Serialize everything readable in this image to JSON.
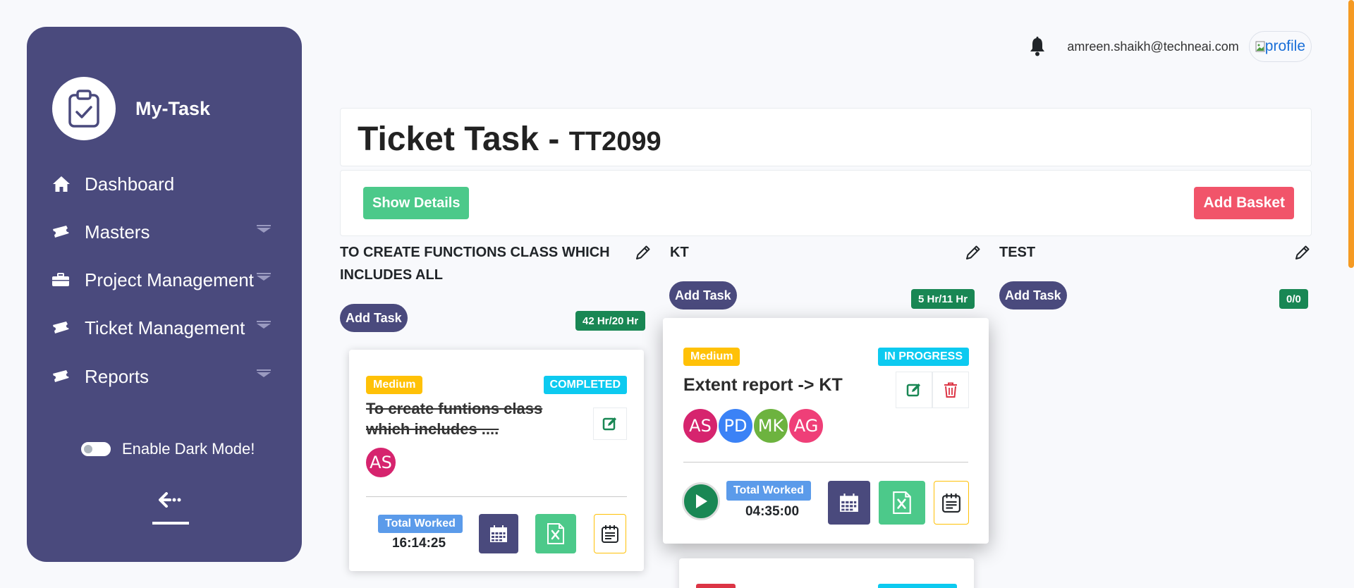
{
  "brand": {
    "name": "My-Task"
  },
  "sidebar": {
    "items": [
      {
        "label": "Dashboard"
      },
      {
        "label": "Masters"
      },
      {
        "label": "Project Management"
      },
      {
        "label": "Ticket Management"
      },
      {
        "label": "Reports"
      }
    ],
    "dark_mode_label": "Enable Dark Mode!"
  },
  "topbar": {
    "email": "amreen.shaikh@techneai.com",
    "profile_alt": "profile"
  },
  "page": {
    "title": "Ticket Task",
    "separator": " - ",
    "code": "TT2099"
  },
  "actions": {
    "show_details": "Show Details",
    "add_basket": "Add Basket"
  },
  "columns": [
    {
      "title": "TO CREATE FUNCTIONS CLASS WHICH INCLUDES ALL",
      "add_task": "Add Task",
      "hours": "42 Hr/20 Hr"
    },
    {
      "title": "KT",
      "add_task": "Add Task",
      "hours": "5 Hr/11 Hr"
    },
    {
      "title": "TEST",
      "add_task": "Add Task",
      "hours": "0/0"
    }
  ],
  "tasks": [
    {
      "priority": "Medium",
      "status": "COMPLETED",
      "title_line1": "To create funtions class",
      "title_line2": "which includes ....",
      "avatars": [
        "AS"
      ],
      "total_worked_label": "Total Worked",
      "total_worked": "16:14:25"
    },
    {
      "priority": "Medium",
      "status": "IN PROGRESS",
      "title": "Extent report -> KT",
      "avatars": [
        "AS",
        "PD",
        "MK",
        "AG"
      ],
      "total_worked_label": "Total Worked",
      "total_worked": "04:35:00"
    }
  ],
  "colors": {
    "sidebar": "#4a4a7d",
    "green": "#4cc98a",
    "red": "#f1546a",
    "warning": "#ffc107",
    "info": "#0dcaf0",
    "success": "#198754",
    "avatars": [
      "#d6246e",
      "#3b82f6",
      "#6db33f",
      "#ef3f78"
    ]
  }
}
